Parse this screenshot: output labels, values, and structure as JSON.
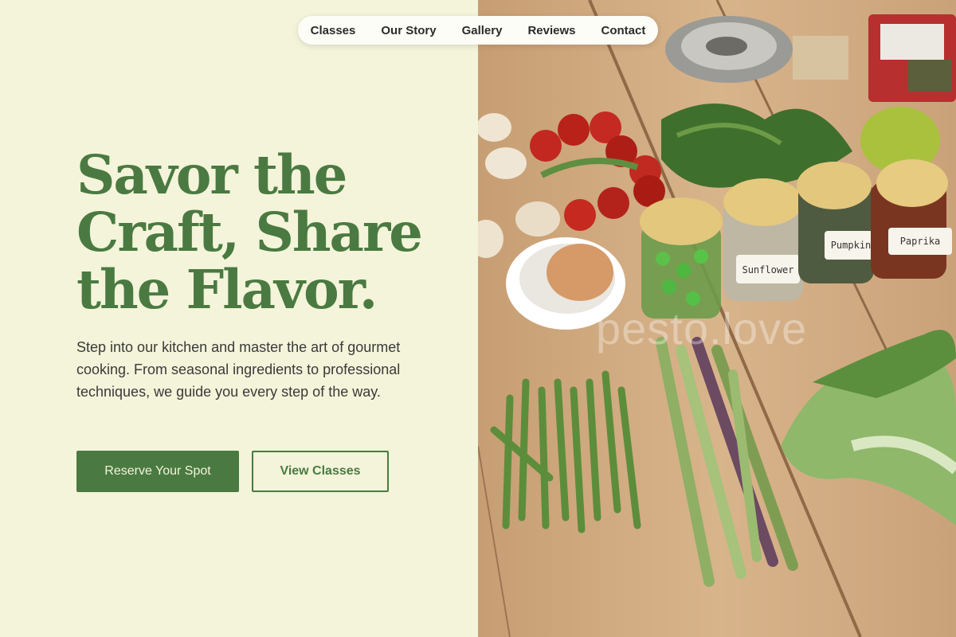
{
  "nav": {
    "items": [
      {
        "label": "Classes"
      },
      {
        "label": "Our Story"
      },
      {
        "label": "Gallery"
      },
      {
        "label": "Reviews"
      },
      {
        "label": "Contact"
      }
    ]
  },
  "hero": {
    "title_lines": [
      "Savor the",
      "Craft, Share",
      "the Flavor."
    ],
    "description": "Step into our kitchen and master the art of gourmet cooking. From seasonal ingredients to professional techniques, we guide you every step of the way.",
    "primary_button": "Reserve Your Spot",
    "secondary_button": "View Classes"
  },
  "image": {
    "watermark": "pesto.love",
    "jar_labels": [
      "Sunflower",
      "Pumpkin",
      "Paprika"
    ]
  },
  "colors": {
    "accent": "#4a7a41",
    "background": "#f4f4da"
  }
}
